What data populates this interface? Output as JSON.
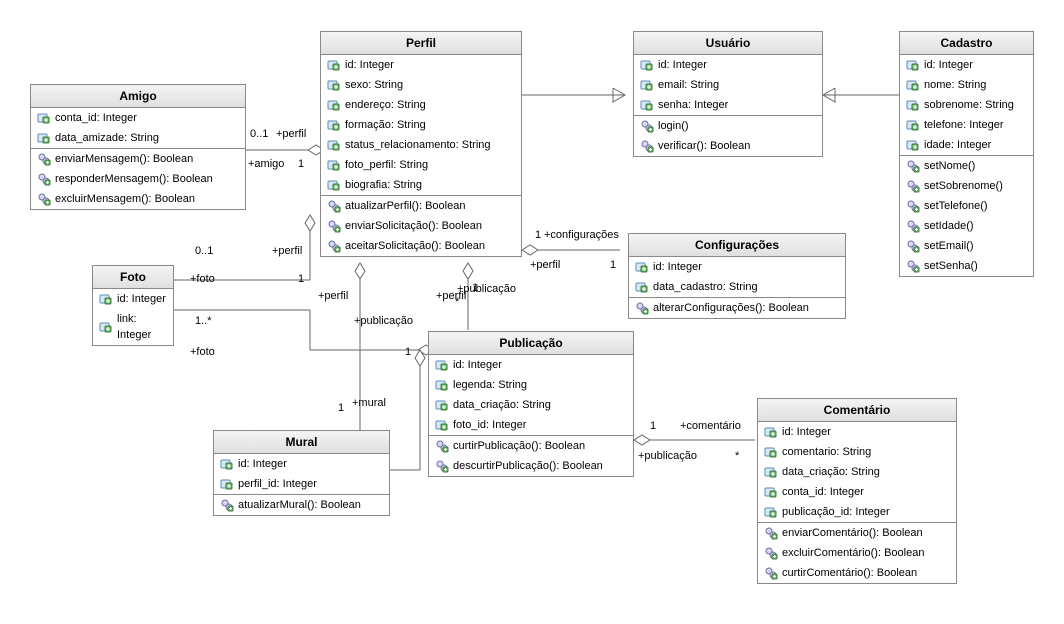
{
  "classes": {
    "amigo": {
      "title": "Amigo",
      "attrs": [
        "conta_id: Integer",
        "data_amizade: String"
      ],
      "ops": [
        "enviarMensagem(): Boolean",
        "responderMensagem(): Boolean",
        "excluirMensagem(): Boolean"
      ]
    },
    "perfil": {
      "title": "Perfil",
      "attrs": [
        "id: Integer",
        "sexo: String",
        "endereço: String",
        "formação: String",
        "status_relacionamento: String",
        "foto_perfil: String",
        "biografia: String"
      ],
      "ops": [
        "atualizarPerfil(): Boolean",
        "enviarSolicitação(): Boolean",
        "aceitarSolicitação(): Boolean"
      ]
    },
    "usuario": {
      "title": "Usuário",
      "attrs": [
        "id: Integer",
        "email: String",
        "senha: Integer"
      ],
      "ops": [
        "login()",
        "verificar(): Boolean"
      ]
    },
    "cadastro": {
      "title": "Cadastro",
      "attrs": [
        "id: Integer",
        "nome: String",
        "sobrenome: String",
        "telefone: Integer",
        "idade: Integer"
      ],
      "ops": [
        "setNome()",
        "setSobrenome()",
        "setTelefone()",
        "setIdade()",
        "setEmail()",
        "setSenha()"
      ]
    },
    "foto": {
      "title": "Foto",
      "attrs": [
        "id: Integer",
        "link: Integer"
      ],
      "ops": []
    },
    "configuracoes": {
      "title": "Configurações",
      "attrs": [
        "id: Integer",
        "data_cadastro: String"
      ],
      "ops": [
        "alterarConfigurações(): Boolean"
      ]
    },
    "mural": {
      "title": "Mural",
      "attrs": [
        "id: Integer",
        "perfil_id: Integer"
      ],
      "ops": [
        "atualizarMural(): Boolean"
      ]
    },
    "publicacao": {
      "title": "Publicação",
      "attrs": [
        "id: Integer",
        "legenda: String",
        "data_criação: String",
        "foto_id: Integer"
      ],
      "ops": [
        "curtirPublicação(): Boolean",
        "descurtirPublicação(): Boolean"
      ]
    },
    "comentario": {
      "title": "Comentário",
      "attrs": [
        "id: Integer",
        "comentario: String",
        "data_criação: String",
        "conta_id: Integer",
        "publicação_id: Integer"
      ],
      "ops": [
        "enviarComentário(): Boolean",
        "excluirComentário(): Boolean",
        "curtirComentário(): Boolean"
      ]
    }
  },
  "labels": {
    "amigo_perfil_left": "0..1",
    "amigo_perfil_right": "+perfil",
    "amigo_perfil_bottom_left": "+amigo",
    "amigo_perfil_bottom_right": "1",
    "foto_perfil_top_left": "0..1",
    "foto_perfil_top_right": "+perfil",
    "foto_perfil_mid_left": "+foto",
    "foto_perfil_mid_right": "1",
    "foto_perfil_bot_left": "1..*",
    "foto_pub_left": "+foto",
    "foto_pub_right": "1",
    "perfil_config_top_left": "1",
    "perfil_config_top_right": "+configurações",
    "perfil_config_bot_left": "+perfil",
    "perfil_config_bot_right": "1",
    "perfil_pub_top_left": "+perfil",
    "perfil_pub_top_right": "1",
    "perfil_pub_bot_left": "+publicação",
    "perfil_pub_bot_right": "*",
    "perfil_mural_top": "+perfil",
    "perfil_mural_bot_left": "1",
    "perfil_mural_bot_right": "+mural",
    "mural_pub_left": "+publicação",
    "pub_com_top_left": "1",
    "pub_com_top_right": "+comentário",
    "pub_com_bot_left": "+publicação",
    "pub_com_bot_right": "*"
  },
  "chart_data": {
    "type": "uml_class_diagram",
    "classes": [
      "Amigo",
      "Perfil",
      "Usuário",
      "Cadastro",
      "Foto",
      "Configurações",
      "Mural",
      "Publicação",
      "Comentário"
    ],
    "relationships": [
      {
        "from": "Perfil",
        "to": "Usuário",
        "type": "generalization"
      },
      {
        "from": "Cadastro",
        "to": "Usuário",
        "type": "generalization"
      },
      {
        "from": "Amigo",
        "to": "Perfil",
        "type": "aggregation",
        "role_from": "+amigo",
        "mult_from": "1",
        "role_to": "+perfil",
        "mult_to": "0..1"
      },
      {
        "from": "Foto",
        "to": "Perfil",
        "type": "aggregation",
        "role_from": "+foto",
        "mult_from": "1",
        "role_to": "+perfil",
        "mult_to": "0..1"
      },
      {
        "from": "Foto",
        "to": "Publicação",
        "type": "aggregation",
        "role_from": "+foto",
        "mult_from": "1",
        "extra_mult": "1..*"
      },
      {
        "from": "Configurações",
        "to": "Perfil",
        "type": "aggregation",
        "role_from": "+configurações",
        "mult_from": "1",
        "role_to": "+perfil",
        "mult_to": "1"
      },
      {
        "from": "Perfil",
        "to": "Publicação",
        "type": "aggregation",
        "role_from": "+perfil",
        "mult_from": "1",
        "role_to": "+publicação",
        "mult_to": "*"
      },
      {
        "from": "Perfil",
        "to": "Mural",
        "type": "aggregation",
        "role_from": "+perfil",
        "mult_from": "",
        "role_to": "+mural",
        "mult_to": "1"
      },
      {
        "from": "Mural",
        "to": "Publicação",
        "type": "aggregation",
        "role_to": "+publicação"
      },
      {
        "from": "Publicação",
        "to": "Comentário",
        "type": "aggregation",
        "role_from": "+publicação",
        "mult_from": "1",
        "role_to": "+comentário",
        "mult_to": "*"
      }
    ]
  }
}
